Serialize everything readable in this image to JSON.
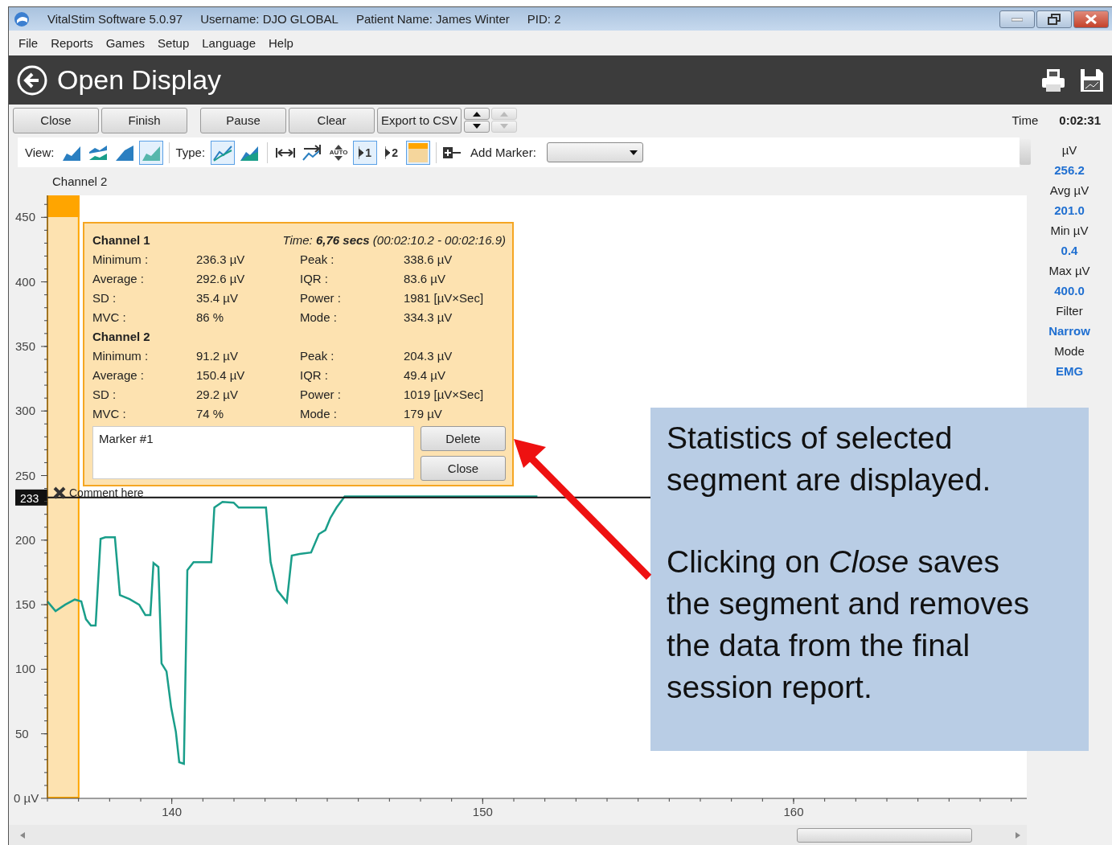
{
  "window": {
    "title_parts": [
      "VitalStim Software 5.0.97",
      "Username: DJO GLOBAL",
      "Patient Name: James Winter",
      "PID: 2"
    ]
  },
  "menu": [
    "File",
    "Reports",
    "Games",
    "Setup",
    "Language",
    "Help"
  ],
  "header": {
    "title": "Open Display"
  },
  "buttons": [
    {
      "label": "Close"
    },
    {
      "label": "Finish"
    },
    {
      "label": "Pause"
    },
    {
      "label": "Clear"
    },
    {
      "label": "Export to CSV"
    }
  ],
  "spin_buttons": [
    {
      "disabled": false
    },
    {
      "disabled": true
    }
  ],
  "time": {
    "label": "Time",
    "value": "0:02:31"
  },
  "toolbar": {
    "view_label": "View:",
    "view_buttons": [
      {
        "selected": false
      },
      {
        "selected": false
      },
      {
        "selected": false
      },
      {
        "selected": true
      }
    ],
    "type_label": "Type:",
    "type_buttons": [
      {
        "selected": true
      },
      {
        "selected": false
      }
    ],
    "tools": [
      {
        "kind": "fit",
        "selected": false
      },
      {
        "kind": "overlay",
        "selected": false
      },
      {
        "kind": "auto",
        "label": "AUTO",
        "selected": false
      },
      {
        "kind": "channel",
        "label": "1",
        "selected": true
      },
      {
        "kind": "channel",
        "label": "2",
        "selected": false
      },
      {
        "kind": "highlight",
        "selected": true
      }
    ],
    "marker_label": "Add Marker:"
  },
  "side_stats": [
    {
      "label": "µV",
      "value": "256.2"
    },
    {
      "label": "Avg µV",
      "value": "201.0"
    },
    {
      "label": "Min µV",
      "value": "0.4"
    },
    {
      "label": "Max µV",
      "value": "400.0"
    },
    {
      "label": "Filter",
      "value": "Narrow"
    },
    {
      "label": "Mode",
      "value": "EMG"
    }
  ],
  "chart_data": {
    "type": "line",
    "xlim": [
      136,
      167.5
    ],
    "ylim": [
      0,
      467
    ],
    "xticks": [
      140,
      150,
      160
    ],
    "yticks": [
      {
        "value": 0,
        "label": "0 µV"
      },
      50,
      100,
      150,
      200,
      250,
      300,
      350,
      400,
      450
    ],
    "series": [
      {
        "name": "Channel 2",
        "color": "#1a9e8a",
        "x": [
          136.0,
          136.26,
          136.57,
          136.88,
          137.09,
          137.24,
          137.4,
          137.55,
          137.71,
          137.86,
          138.17,
          138.33,
          138.64,
          138.95,
          139.15,
          139.31,
          139.41,
          139.57,
          139.67,
          139.83,
          139.98,
          140.13,
          140.24,
          140.39,
          140.5,
          140.7,
          141.27,
          141.37,
          141.63,
          141.99,
          142.15,
          143.03,
          143.18,
          143.39,
          143.7,
          143.86,
          144.11,
          144.48,
          144.73,
          144.94,
          145.1,
          145.3,
          145.56,
          145.87,
          151.76
        ],
        "values": [
          152.5,
          145,
          150,
          154,
          152.5,
          138.8,
          133.8,
          133.8,
          201,
          202.2,
          202.2,
          157.4,
          154.3,
          150,
          141.9,
          141.9,
          182.3,
          179.2,
          104.5,
          98.3,
          70.3,
          51.6,
          28,
          26.8,
          176.7,
          182.9,
          182.9,
          225.2,
          229.6,
          229,
          225.2,
          225.2,
          182.9,
          161.2,
          151.9,
          188,
          189.2,
          190.4,
          204.7,
          207.8,
          217.2,
          225.2,
          233.9,
          233.9,
          233.9
        ]
      }
    ],
    "ref_lines": [
      {
        "axis": "y",
        "value": 233,
        "label": "233",
        "color": "#111111"
      }
    ],
    "bands": [
      {
        "axis": "x",
        "from": 136,
        "to": 137.03,
        "color": "#fde2b0"
      }
    ]
  },
  "comment": {
    "text": "Comment here"
  },
  "popup": {
    "time": "Time: **6,76 secs** (00:02:10.2 - 00:02:16.9)",
    "channels": [
      {
        "title": "Channel 1",
        "rows": [
          [
            "Minimum :",
            "236.3 µV",
            "Peak :",
            "338.6 µV"
          ],
          [
            "Average :",
            "292.6 µV",
            "IQR :",
            "83.6 µV"
          ],
          [
            "SD :",
            "35.4 µV",
            "Power :",
            "1981 [µV×Sec]"
          ],
          [
            "MVC :",
            "86 %",
            "Mode :",
            "334.3 µV"
          ]
        ]
      },
      {
        "title": "Channel 2",
        "rows": [
          [
            "Minimum :",
            "91.2 µV",
            "Peak :",
            "204.3 µV"
          ],
          [
            "Average :",
            "150.4 µV",
            "IQR :",
            "49.4 µV"
          ],
          [
            "SD :",
            "29.2 µV",
            "Power :",
            "1019 [µV×Sec]"
          ],
          [
            "MVC :",
            "74 %",
            "Mode :",
            "179 µV"
          ]
        ]
      }
    ],
    "note": "Marker #1",
    "buttons": [
      "Delete",
      "Close"
    ]
  },
  "callout": {
    "paragraphs": [
      "Statistics of selected segment are displayed.",
      "Clicking on *Close* saves the segment and removes the data from the final session report."
    ]
  }
}
